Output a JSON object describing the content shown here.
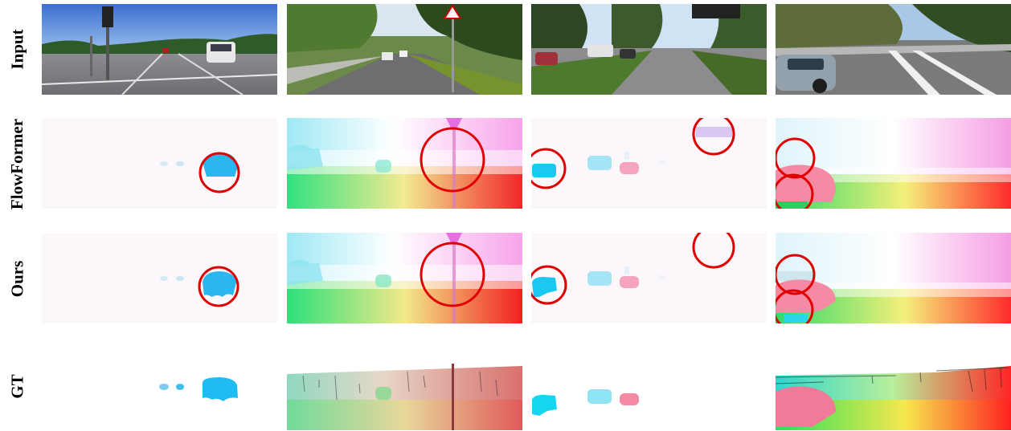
{
  "row_labels": {
    "input": "Input",
    "flowformer": "FlowFormer",
    "ours": "Ours",
    "gt": "GT"
  },
  "colors": {
    "highlight_circle": "#e00000",
    "car_cyan": "#1cc8f2",
    "car_pink": "#f07a98",
    "background_flow": "#fbf7fa"
  }
}
